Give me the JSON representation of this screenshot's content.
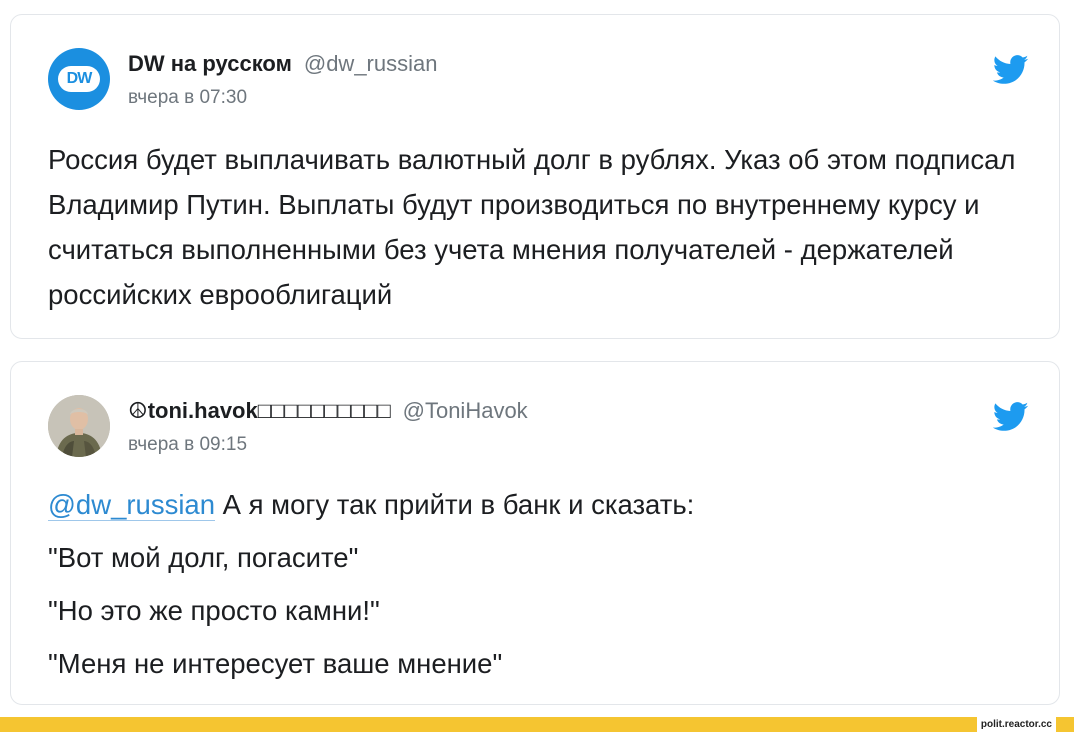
{
  "tweets": [
    {
      "author_name": "DW на русском",
      "handle": "@dw_russian",
      "time": "вчера в 07:30",
      "avatar_text": "DW",
      "text": "Россия будет выплачивать валютный долг в рублях. Указ об этом подписал Владимир Путин. Выплаты будут производиться по внутреннему курсу и считаться выполненными без учета мнения получателей - держателей российских еврооблигаций"
    },
    {
      "author_name": "☮toni.havok□□□□□□□□□□",
      "handle": "@ToniHavok",
      "time": "вчера в 09:15",
      "mention": "@dw_russian",
      "first_line_rest": " А я могу так прийти в банк и сказать:",
      "lines": [
        "\"Вот мой долг, погасите\"",
        "\"Но это же просто камни!\"",
        "\"Меня не интересует ваше мнение\""
      ]
    }
  ],
  "footer": {
    "site": "polit.reactor.cc"
  },
  "colors": {
    "twitter_blue": "#1d9bf0",
    "mention": "#2d8ad1",
    "brand_bar": "#f5c531"
  },
  "icons": {
    "platform": "twitter-bird-icon"
  }
}
